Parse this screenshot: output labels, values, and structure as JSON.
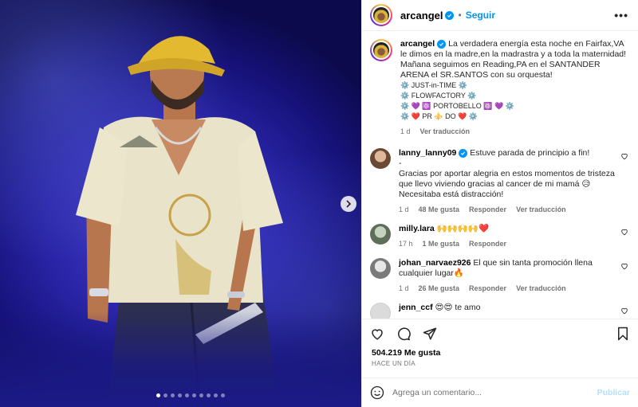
{
  "post": {
    "username": "arcangel",
    "follow_label": "Seguir",
    "separator": "•",
    "more_label": "•••",
    "image_index": 1,
    "image_count": 10
  },
  "caption": {
    "username": "arcangel",
    "lines": [
      "La verdadera energía esta noche en Fairfax,VA le dimos en la madre,en la madrastra y a toda la maternidad!",
      "Mañana seguimos en Reading,PA en el SANTANDER ARENA el SR.SANTOS con su orquesta!",
      "⚙️ JUST-in-TIME ⚙️",
      "⚙️ FLOWFACTORY ⚙️",
      "⚙️ 💜 ⚛️ PORTOBELLO ⚛️ 💜 ⚙️",
      "⚙️ ❤️ PR ⚜️ DO ❤️ ⚙️"
    ],
    "age": "1 d",
    "translate_label": "Ver traducción"
  },
  "comments": [
    {
      "username": "lanny_lanny09",
      "verified": true,
      "text": "Estuve parada de principio a fin!",
      "text2": "-",
      "text3": "Gracias por aportar alegria en estos momentos de tristeza que llevo viviendo gracias al cancer de mi mamá 😥 Necesitaba está distracción!",
      "age": "1 d",
      "likes": "48 Me gusta",
      "reply": "Responder",
      "translate": "Ver traducción"
    },
    {
      "username": "milly.lara",
      "text": "🙌🙌🙌🙌❤️",
      "age": "17 h",
      "likes": "1 Me gusta",
      "reply": "Responder"
    },
    {
      "username": "johan_narvaez926",
      "text": "El que sin tanta promoción llena cualquier lugar🔥",
      "age": "1 d",
      "likes": "26 Me gusta",
      "reply": "Responder",
      "translate": "Ver traducción"
    },
    {
      "username": "jenn_ccf",
      "text": "😍😍 te amo"
    }
  ],
  "footer": {
    "likes": "504.219 Me gusta",
    "time": "HACE UN DÍA",
    "comment_placeholder": "Agrega un comentario...",
    "publish_label": "Publicar"
  },
  "icons": {
    "heart": "heart-icon",
    "comment": "comment-icon",
    "share": "share-icon",
    "save": "bookmark-icon",
    "emoji": "emoji-icon",
    "next": "chevron-right-icon"
  },
  "colors": {
    "accent": "#0095f6",
    "text": "#262626",
    "muted": "#737373"
  }
}
